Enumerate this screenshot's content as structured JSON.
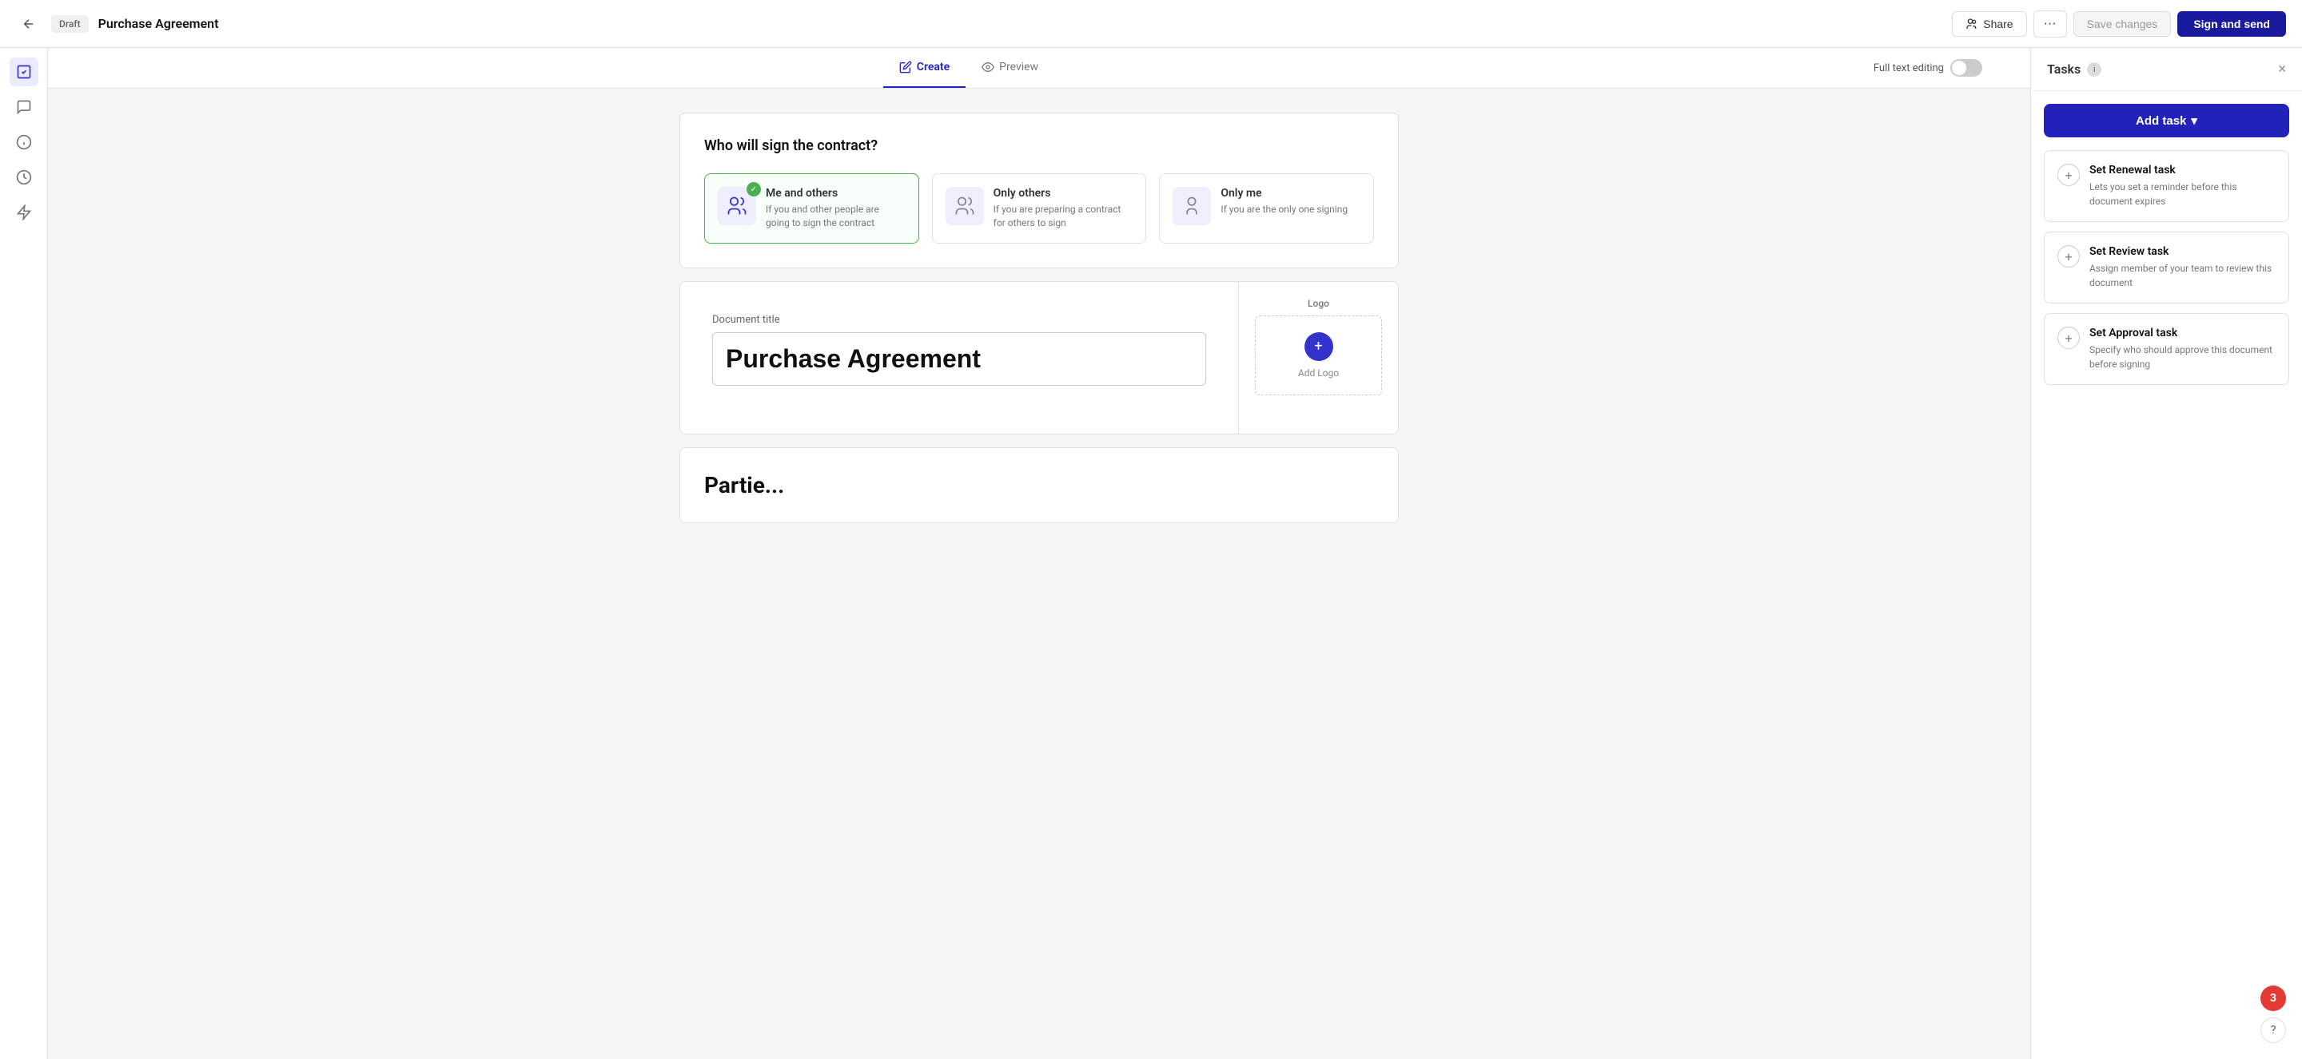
{
  "topbar": {
    "draft_label": "Draft",
    "doc_title": "Purchase Agreement",
    "share_label": "Share",
    "more_label": "···",
    "save_label": "Save changes",
    "sign_label": "Sign and send"
  },
  "tabs": {
    "create_label": "Create",
    "preview_label": "Preview",
    "full_text_editing_label": "Full text editing"
  },
  "signing_section": {
    "title": "Who will sign the contract?",
    "options": [
      {
        "label": "Me and others",
        "description": "If you and other people are going to sign the contract",
        "selected": true
      },
      {
        "label": "Only others",
        "description": "If you are preparing a contract for others to sign",
        "selected": false
      },
      {
        "label": "Only me",
        "description": "If you are the only one signing",
        "selected": false
      }
    ]
  },
  "document": {
    "title_label": "Document title",
    "title_value": "Purchase Agreement",
    "logo_label": "Logo",
    "add_logo_label": "Add Logo",
    "partial_section_title": "Partie..."
  },
  "tasks_panel": {
    "title": "Tasks",
    "add_task_label": "Add task",
    "close_label": "×",
    "tasks": [
      {
        "title": "Set Renewal task",
        "description": "Lets you set a reminder before this document expires"
      },
      {
        "title": "Set Review task",
        "description": "Assign member of your team to review this document"
      },
      {
        "title": "Set Approval task",
        "description": "Specify who should approve this document before signing"
      }
    ]
  },
  "notification": {
    "count": "3"
  },
  "help": {
    "label": "?"
  }
}
